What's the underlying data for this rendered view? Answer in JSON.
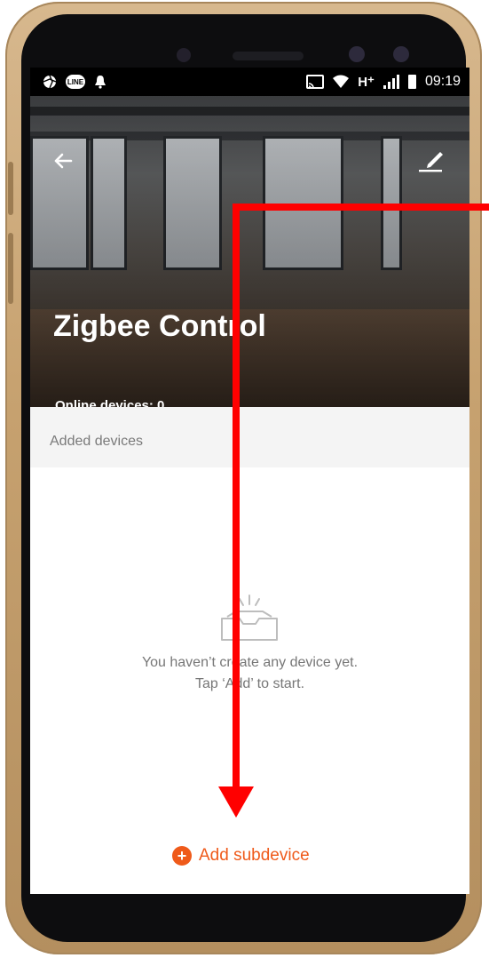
{
  "statusbar": {
    "left_icons": [
      "aperture-icon",
      "line-icon",
      "bell-icon"
    ],
    "line_badge": "LINE",
    "network_type": "H⁺",
    "time": "09:19"
  },
  "header": {
    "title": "Zigbee Control",
    "online_devices": "Online devices: 0"
  },
  "section": {
    "label": "Added devices"
  },
  "empty_state": {
    "line1": "You haven’t create any device yet.",
    "line2": "Tap ‘Add’ to start."
  },
  "action": {
    "add_label": "Add subdevice"
  },
  "colors": {
    "accent": "#ef5a1a",
    "annotation_arrow": "#ff0000",
    "phone_frame": "#c7a270"
  }
}
